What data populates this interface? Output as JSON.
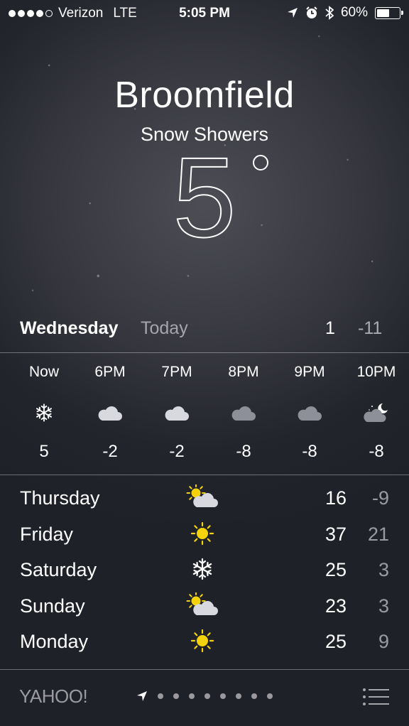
{
  "status_bar": {
    "carrier": "Verizon",
    "network": "LTE",
    "time": "5:05 PM",
    "battery": "60%",
    "battery_level": 0.6,
    "signal_bars": 4
  },
  "header": {
    "city": "Broomfield",
    "condition": "Snow Showers",
    "temperature": "5"
  },
  "today": {
    "day": "Wednesday",
    "label": "Today",
    "high": "1",
    "low": "-11"
  },
  "hourly": [
    {
      "time": "Now",
      "icon": "snowflake-icon",
      "temp": "5"
    },
    {
      "time": "6PM",
      "icon": "cloud-icon",
      "temp": "-2"
    },
    {
      "time": "7PM",
      "icon": "cloud-icon",
      "temp": "-2"
    },
    {
      "time": "8PM",
      "icon": "cloud-icon",
      "temp": "-8"
    },
    {
      "time": "9PM",
      "icon": "cloud-icon",
      "temp": "-8"
    },
    {
      "time": "10PM",
      "icon": "partly-cloudy-night-icon",
      "temp": "-8"
    }
  ],
  "daily": [
    {
      "day": "Thursday",
      "icon": "partly-cloudy-icon",
      "high": "16",
      "low": "-9"
    },
    {
      "day": "Friday",
      "icon": "sun-icon",
      "high": "37",
      "low": "21"
    },
    {
      "day": "Saturday",
      "icon": "snowflake-icon",
      "high": "25",
      "low": "3"
    },
    {
      "day": "Sunday",
      "icon": "partly-cloudy-icon",
      "high": "23",
      "low": "3"
    },
    {
      "day": "Monday",
      "icon": "sun-icon",
      "high": "25",
      "low": "9"
    }
  ],
  "footer": {
    "brand": "YAHOO!",
    "page_count": 8
  },
  "colors": {
    "sun": "#f5d30b",
    "cloud_light": "#d8d9de",
    "cloud_dark": "#8e9099"
  }
}
